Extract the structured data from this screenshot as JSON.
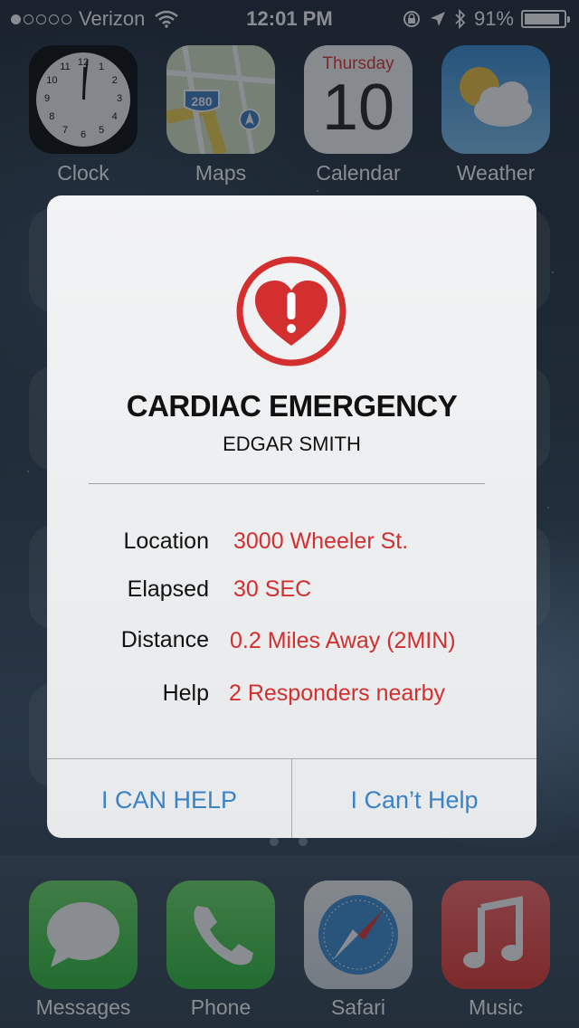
{
  "status_bar": {
    "carrier": "Verizon",
    "time": "12:01 PM",
    "battery_text": "91%",
    "battery_level": 0.91
  },
  "apps": {
    "clock": "Clock",
    "maps": "Maps",
    "maps_shield": "280",
    "calendar": "Calendar",
    "calendar_day": "Thursday",
    "calendar_date": "10",
    "weather": "Weather",
    "clock_numerals": [
      "12",
      "1",
      "2",
      "3",
      "4",
      "5",
      "6",
      "7",
      "8",
      "9",
      "10",
      "11"
    ]
  },
  "dock": {
    "messages": "Messages",
    "phone": "Phone",
    "safari": "Safari",
    "music": "Music"
  },
  "alert": {
    "icon": "heart-alert-icon",
    "accent_color": "#d32f2f",
    "title": "CARDIAC EMERGENCY",
    "subtitle": "EDGAR SMITH",
    "rows": [
      {
        "label": "Location",
        "value": "3000 Wheeler St."
      },
      {
        "label": "Elapsed",
        "value": "30 SEC"
      },
      {
        "label": "Distance",
        "value": "0.2 Miles Away (2MIN)"
      },
      {
        "label": "Help",
        "value": "2 Responders nearby"
      }
    ],
    "primary_button": "I CAN HELP",
    "secondary_button": "I Can’t Help",
    "button_color": "#3b82c6"
  }
}
